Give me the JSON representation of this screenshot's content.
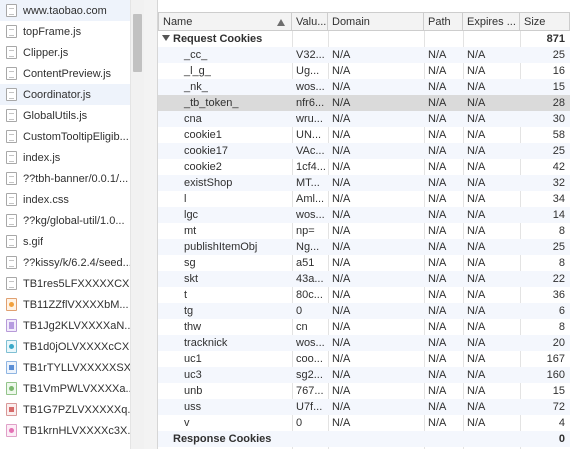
{
  "requests": [
    {
      "name": "www.taobao.com",
      "icon": "document-icon",
      "selected": true
    },
    {
      "name": "topFrame.js",
      "icon": "document-icon"
    },
    {
      "name": "Clipper.js",
      "icon": "document-icon"
    },
    {
      "name": "ContentPreview.js",
      "icon": "document-icon"
    },
    {
      "name": "Coordinator.js",
      "icon": "document-icon",
      "selected": true
    },
    {
      "name": "GlobalUtils.js",
      "icon": "document-icon"
    },
    {
      "name": "CustomTooltipEligib...",
      "icon": "document-icon"
    },
    {
      "name": "index.js",
      "icon": "script-icon"
    },
    {
      "name": "??tbh-banner/0.0.1/...",
      "icon": "document-icon"
    },
    {
      "name": "index.css",
      "icon": "script-icon"
    },
    {
      "name": "??kg/global-util/1.0...",
      "icon": "document-icon"
    },
    {
      "name": "s.gif",
      "icon": "document-icon"
    },
    {
      "name": "??kissy/k/6.2.4/seed...",
      "icon": "document-icon"
    },
    {
      "name": "TB1res5LFXXXXXCX...",
      "icon": "document-icon"
    },
    {
      "name": "TB11ZZflVXXXXbM...",
      "icon": "image-orange-icon"
    },
    {
      "name": "TB1Jg2KLVXXXXaN...",
      "icon": "image-purple-icon"
    },
    {
      "name": "TB1d0jOLVXXXXcCX...",
      "icon": "image-cyan-icon"
    },
    {
      "name": "TB1rTYLLVXXXXXSX...",
      "icon": "image-blue-icon"
    },
    {
      "name": "TB1VmPWLVXXXXa...",
      "icon": "image-green-icon"
    },
    {
      "name": "TB1G7PZLVXXXXXq...",
      "icon": "image-red-icon"
    },
    {
      "name": "TB1krnHLVXXXXc3X...",
      "icon": "image-pink-icon"
    }
  ],
  "table": {
    "headers": {
      "name": "Name",
      "value": "Valu...",
      "domain": "Domain",
      "path": "Path",
      "expires": "Expires ...",
      "size": "Size"
    },
    "request_group": {
      "label": "Request Cookies",
      "size": "871"
    },
    "rows": [
      {
        "name": "_cc_",
        "value": "V32...",
        "domain": "N/A",
        "path": "N/A",
        "expires": "N/A",
        "size": "25"
      },
      {
        "name": "_l_g_",
        "value": "Ug...",
        "domain": "N/A",
        "path": "N/A",
        "expires": "N/A",
        "size": "16"
      },
      {
        "name": "_nk_",
        "value": "wos...",
        "domain": "N/A",
        "path": "N/A",
        "expires": "N/A",
        "size": "15"
      },
      {
        "name": "_tb_token_",
        "value": "nfr6...",
        "domain": "N/A",
        "path": "N/A",
        "expires": "N/A",
        "size": "28",
        "highlighted": true
      },
      {
        "name": "cna",
        "value": "wru...",
        "domain": "N/A",
        "path": "N/A",
        "expires": "N/A",
        "size": "30"
      },
      {
        "name": "cookie1",
        "value": "UN...",
        "domain": "N/A",
        "path": "N/A",
        "expires": "N/A",
        "size": "58"
      },
      {
        "name": "cookie17",
        "value": "VAc...",
        "domain": "N/A",
        "path": "N/A",
        "expires": "N/A",
        "size": "25"
      },
      {
        "name": "cookie2",
        "value": "1cf4...",
        "domain": "N/A",
        "path": "N/A",
        "expires": "N/A",
        "size": "42"
      },
      {
        "name": "existShop",
        "value": "MT...",
        "domain": "N/A",
        "path": "N/A",
        "expires": "N/A",
        "size": "32"
      },
      {
        "name": "l",
        "value": "Aml...",
        "domain": "N/A",
        "path": "N/A",
        "expires": "N/A",
        "size": "34"
      },
      {
        "name": "lgc",
        "value": "wos...",
        "domain": "N/A",
        "path": "N/A",
        "expires": "N/A",
        "size": "14"
      },
      {
        "name": "mt",
        "value": "np=",
        "domain": "N/A",
        "path": "N/A",
        "expires": "N/A",
        "size": "8"
      },
      {
        "name": "publishItemObj",
        "value": "Ng...",
        "domain": "N/A",
        "path": "N/A",
        "expires": "N/A",
        "size": "25"
      },
      {
        "name": "sg",
        "value": "a51",
        "domain": "N/A",
        "path": "N/A",
        "expires": "N/A",
        "size": "8"
      },
      {
        "name": "skt",
        "value": "43a...",
        "domain": "N/A",
        "path": "N/A",
        "expires": "N/A",
        "size": "22"
      },
      {
        "name": "t",
        "value": "80c...",
        "domain": "N/A",
        "path": "N/A",
        "expires": "N/A",
        "size": "36"
      },
      {
        "name": "tg",
        "value": "0",
        "domain": "N/A",
        "path": "N/A",
        "expires": "N/A",
        "size": "6"
      },
      {
        "name": "thw",
        "value": "cn",
        "domain": "N/A",
        "path": "N/A",
        "expires": "N/A",
        "size": "8"
      },
      {
        "name": "tracknick",
        "value": "wos...",
        "domain": "N/A",
        "path": "N/A",
        "expires": "N/A",
        "size": "20"
      },
      {
        "name": "uc1",
        "value": "coo...",
        "domain": "N/A",
        "path": "N/A",
        "expires": "N/A",
        "size": "167"
      },
      {
        "name": "uc3",
        "value": "sg2...",
        "domain": "N/A",
        "path": "N/A",
        "expires": "N/A",
        "size": "160"
      },
      {
        "name": "unb",
        "value": "767...",
        "domain": "N/A",
        "path": "N/A",
        "expires": "N/A",
        "size": "15"
      },
      {
        "name": "uss",
        "value": "U7f...",
        "domain": "N/A",
        "path": "N/A",
        "expires": "N/A",
        "size": "72"
      },
      {
        "name": "v",
        "value": "0",
        "domain": "N/A",
        "path": "N/A",
        "expires": "N/A",
        "size": "4"
      }
    ],
    "response_group": {
      "label": "Response Cookies",
      "size": "0"
    }
  }
}
